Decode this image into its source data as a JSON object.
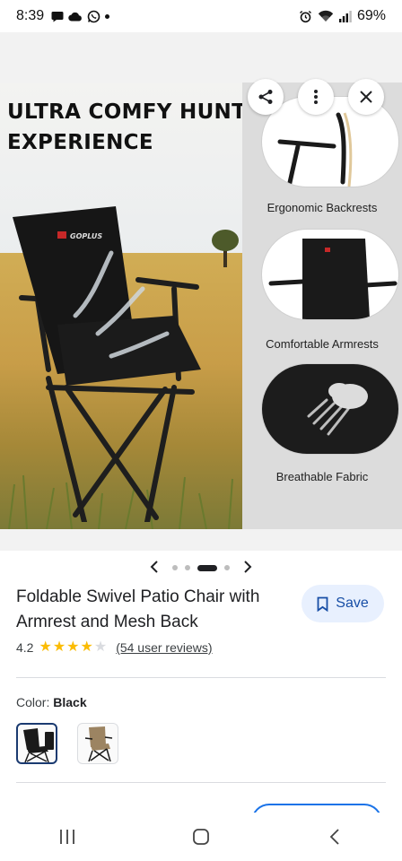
{
  "status_bar": {
    "time": "8:39",
    "battery": "69%",
    "left_icons": [
      "chat-bubble-icon",
      "cloud-icon",
      "whatsapp-icon",
      "notification-dot"
    ],
    "right_icons": [
      "alarm-icon",
      "wifi-icon",
      "signal-icon"
    ]
  },
  "hero": {
    "headline_line1": "ULTRA COMFY HUNTING",
    "headline_line2": "EXPERIENCE",
    "brand": "GOPLUS",
    "features": [
      {
        "label": "Ergonomic Backrests"
      },
      {
        "label": "Comfortable Armrests"
      },
      {
        "label": "Breathable Fabric"
      }
    ],
    "actions": [
      "share-icon",
      "more-vert-icon",
      "close-icon"
    ]
  },
  "carousel": {
    "prev_icon": "chevron-left-icon",
    "next_icon": "chevron-right-icon",
    "dot_count": 4,
    "active_index": 2
  },
  "product": {
    "title": "Foldable Swivel Patio Chair with Armrest and Mesh Back",
    "save_label": "Save",
    "rating": "4.2",
    "stars_filled": 4,
    "stars_total": 5,
    "reviews_label": "(54 user reviews)",
    "color_label": "Color:",
    "color_value": "Black",
    "swatches": [
      {
        "name": "Black",
        "selected": true
      },
      {
        "name": "Tan",
        "selected": false
      }
    ]
  },
  "colors": {
    "accent": "#1a73e8",
    "save_bg": "#e8f0fe",
    "star": "#fbbc04",
    "star_empty": "#dadce0"
  },
  "nav_bar": [
    "recents-icon",
    "home-icon",
    "back-icon"
  ]
}
